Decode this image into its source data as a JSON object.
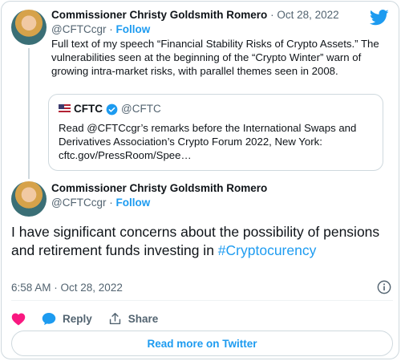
{
  "parent": {
    "author_name": "Commissioner Christy Goldsmith Romero",
    "separator": "·",
    "date": "Oct 28, 2022",
    "handle": "@CFTCcgr",
    "follow_label": "Follow",
    "text": "Full text of my speech “Financial Stability Risks of Crypto Assets.” The vulnerabilities seen at the beginning of the “Crypto Winter” warn of growing intra-market risks, with parallel themes seen in 2008."
  },
  "quote": {
    "name": "CFTC",
    "handle": "@CFTC",
    "text": "Read @CFTCcgr’s remarks before the International Swaps and Derivatives Association’s Crypto Forum 2022, New York: cftc.gov/PressRoom/Spee…"
  },
  "main": {
    "author_name": "Commissioner Christy Goldsmith Romero",
    "handle": "@CFTCcgr",
    "separator": "·",
    "follow_label": "Follow",
    "text": "I have significant concerns about the possibility of pensions and retirement funds investing in",
    "hashtag": "#Cryptocurency",
    "timestamp": "6:58 AM · Oct 28, 2022"
  },
  "actions": {
    "reply_label": "Reply",
    "share_label": "Share"
  },
  "footer": {
    "read_more_label": "Read more on Twitter"
  },
  "colors": {
    "accent": "#1d9bf0",
    "like": "#f91880",
    "muted": "#536471",
    "border": "#cfd9de"
  },
  "icons": [
    "twitter-bird-icon",
    "flag-icon",
    "verified-badge-icon",
    "info-icon",
    "heart-icon",
    "reply-bubble-icon",
    "share-icon"
  ]
}
